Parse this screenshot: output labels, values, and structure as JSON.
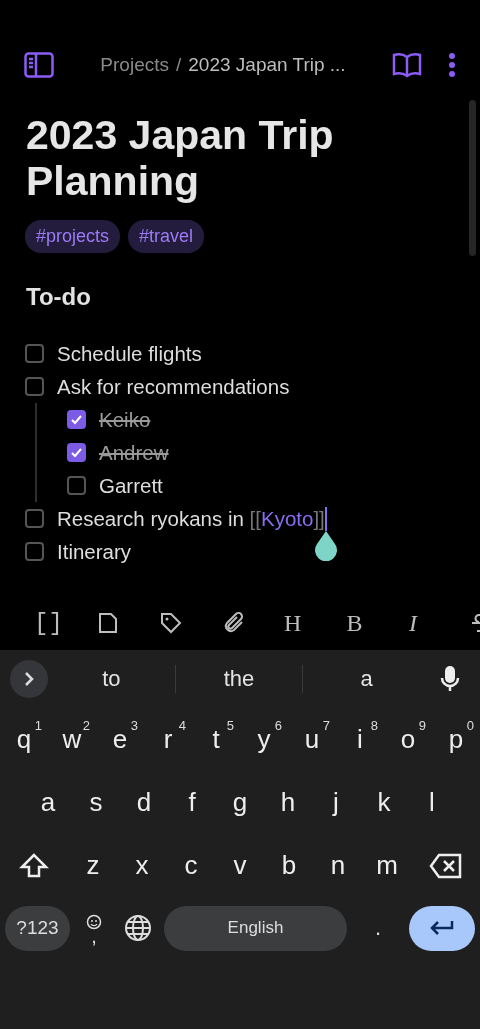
{
  "header": {
    "breadcrumb": [
      {
        "label": "Projects"
      },
      {
        "label": "/"
      },
      {
        "label": "2023 Japan Trip ..."
      }
    ]
  },
  "note": {
    "title": "2023 Japan Trip Planning",
    "tags": [
      "#projects",
      "#travel"
    ],
    "heading": "To-do",
    "todos": [
      {
        "text": "Schedule flights",
        "checked": false
      },
      {
        "text": "Ask for recommendations",
        "checked": false,
        "children": [
          {
            "text": "Keiko",
            "checked": true
          },
          {
            "text": "Andrew",
            "checked": true
          },
          {
            "text": "Garrett",
            "checked": false
          }
        ]
      },
      {
        "text": "Research ryokans in ",
        "checked": false,
        "link_open": "[[",
        "link": "Kyoto",
        "link_close": "]]",
        "cursor": true
      },
      {
        "text": "Itinerary",
        "checked": false
      }
    ]
  },
  "toolbar": [
    {
      "kind": "text",
      "label": "[]"
    },
    {
      "kind": "file"
    },
    {
      "kind": "tag"
    },
    {
      "kind": "clip"
    },
    {
      "kind": "text",
      "label": "H"
    },
    {
      "kind": "text",
      "label": "B"
    },
    {
      "kind": "text",
      "label": "I",
      "italic": true
    },
    {
      "kind": "strike"
    }
  ],
  "keyboard": {
    "suggestions": [
      "to",
      "the",
      "a"
    ],
    "rows": [
      [
        {
          "label": "q",
          "hint": "1"
        },
        {
          "label": "w",
          "hint": "2"
        },
        {
          "label": "e",
          "hint": "3"
        },
        {
          "label": "r",
          "hint": "4"
        },
        {
          "label": "t",
          "hint": "5"
        },
        {
          "label": "y",
          "hint": "6"
        },
        {
          "label": "u",
          "hint": "7"
        },
        {
          "label": "i",
          "hint": "8"
        },
        {
          "label": "o",
          "hint": "9"
        },
        {
          "label": "p",
          "hint": "0"
        }
      ],
      [
        {
          "label": "a"
        },
        {
          "label": "s"
        },
        {
          "label": "d"
        },
        {
          "label": "f"
        },
        {
          "label": "g"
        },
        {
          "label": "h"
        },
        {
          "label": "j"
        },
        {
          "label": "k"
        },
        {
          "label": "l"
        }
      ],
      [
        {
          "kind": "shift"
        },
        {
          "label": "z"
        },
        {
          "label": "x"
        },
        {
          "label": "c"
        },
        {
          "label": "v"
        },
        {
          "label": "b"
        },
        {
          "label": "n"
        },
        {
          "label": "m"
        },
        {
          "kind": "backspace"
        }
      ]
    ],
    "symbols": "?123",
    "comma": ",",
    "space": "English",
    "period": "."
  }
}
